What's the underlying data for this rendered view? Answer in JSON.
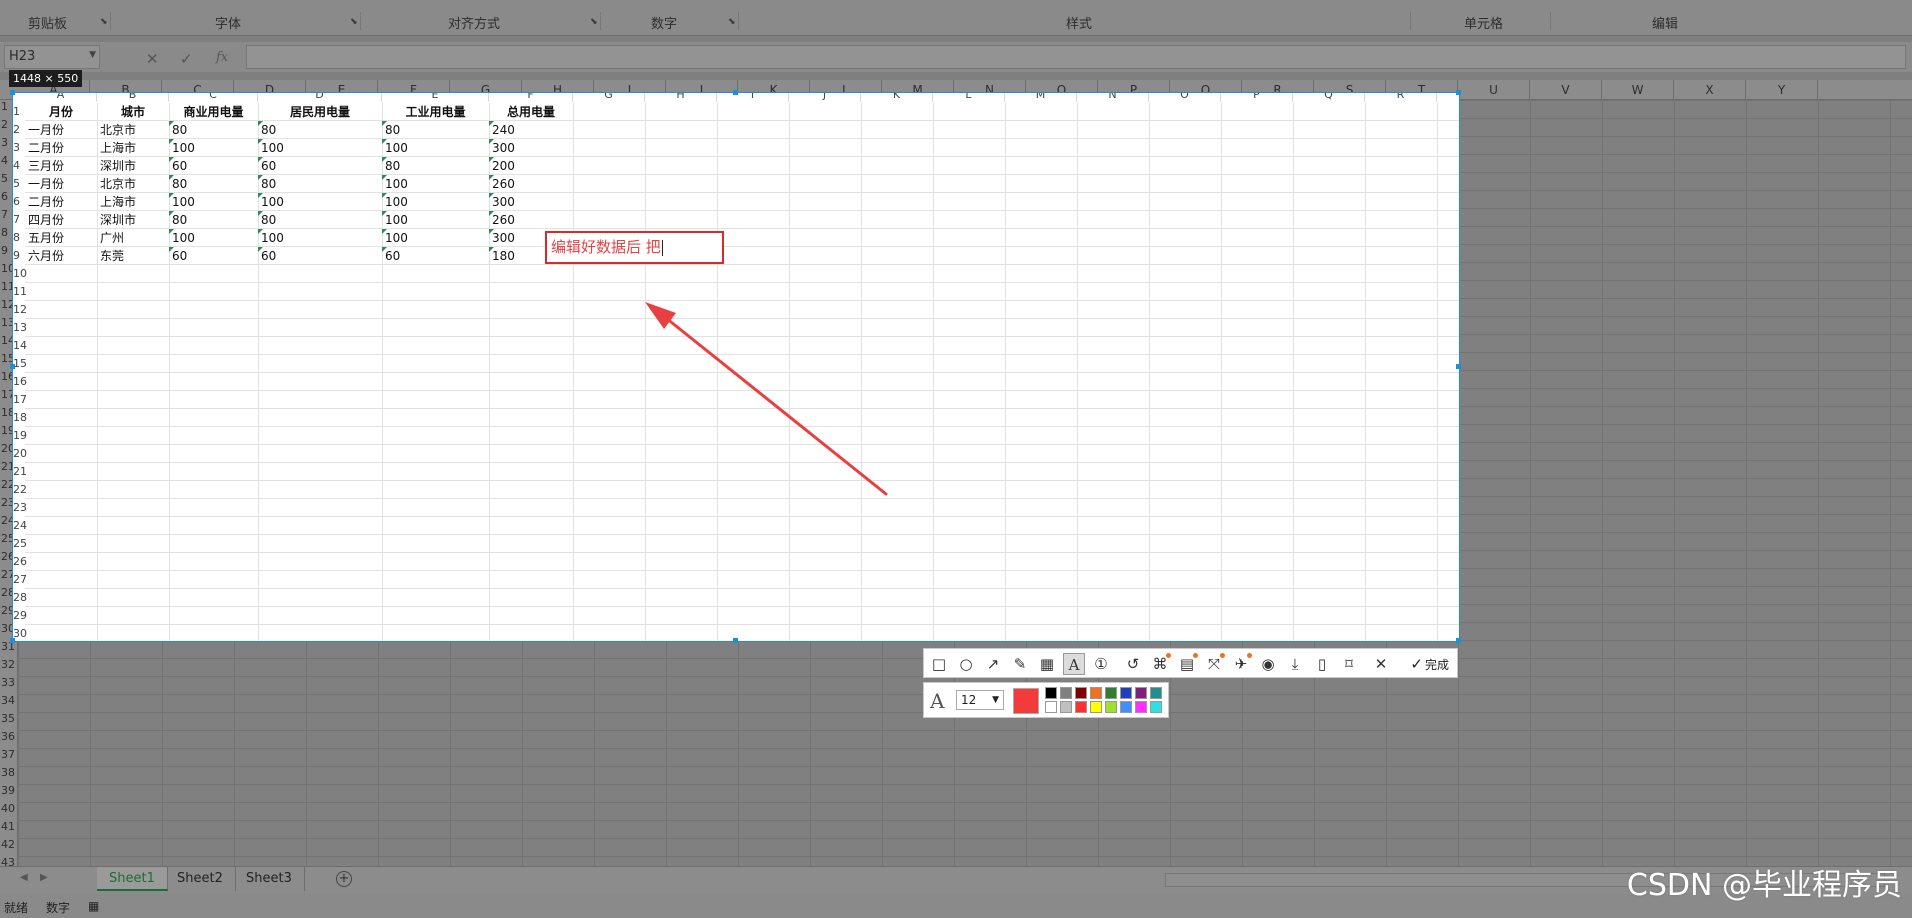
{
  "ribbon": {
    "groups": [
      "剪贴板",
      "字体",
      "对齐方式",
      "数字",
      "样式",
      "单元格",
      "编辑"
    ]
  },
  "formula_bar": {
    "name_box": "H23",
    "cancel_icon": "✕",
    "enter_icon": "✓",
    "fx_label": "fx",
    "value": ""
  },
  "column_letters_outer": [
    "A",
    "B",
    "C",
    "D",
    "E",
    "F",
    "G",
    "H",
    "I",
    "J",
    "K",
    "L",
    "M",
    "N",
    "O",
    "P",
    "Q",
    "R",
    "S",
    "T",
    "U",
    "V",
    "W",
    "X",
    "Y"
  ],
  "row_numbers": [
    "1",
    "2",
    "3",
    "4",
    "5",
    "6",
    "7",
    "8",
    "9",
    "10",
    "11",
    "12",
    "13",
    "14",
    "15",
    "16",
    "17",
    "18",
    "19",
    "20",
    "21",
    "22",
    "23",
    "24",
    "25",
    "26",
    "27",
    "28",
    "29",
    "30",
    "31",
    "32",
    "33",
    "34",
    "35",
    "36",
    "37",
    "38",
    "39",
    "40",
    "41",
    "42",
    "43"
  ],
  "capture": {
    "size_label": "1448 × 550"
  },
  "table": {
    "headers": [
      "月份",
      "城市",
      "商业用电量",
      "居民用电量",
      "工业用电量",
      "总用电量"
    ],
    "rows": [
      [
        "一月份",
        "北京市",
        "80",
        "80",
        "80",
        "240"
      ],
      [
        "二月份",
        "上海市",
        "100",
        "100",
        "100",
        "300"
      ],
      [
        "三月份",
        "深圳市",
        "60",
        "60",
        "80",
        "200"
      ],
      [
        "一月份",
        "北京市",
        "80",
        "80",
        "100",
        "260"
      ],
      [
        "二月份",
        "上海市",
        "100",
        "100",
        "100",
        "300"
      ],
      [
        "四月份",
        "深圳市",
        "80",
        "80",
        "100",
        "260"
      ],
      [
        "五月份",
        "广州",
        "100",
        "100",
        "100",
        "300"
      ],
      [
        "六月份",
        "东莞",
        "60",
        "60",
        "60",
        "180"
      ]
    ]
  },
  "annotation": {
    "text": "编辑好数据后 把",
    "color": "#e14545",
    "border_color": "#d62b2b"
  },
  "toolbar": {
    "tools": [
      "rectangle-icon",
      "ellipse-icon",
      "arrow-icon",
      "pencil-icon",
      "mosaic-icon",
      "text-icon",
      "number-marker-icon",
      "undo-icon",
      "pin-icon",
      "translate-icon",
      "scroll-capture-icon",
      "pin-to-screen-icon",
      "record-icon",
      "download-icon",
      "save-icon",
      "bookmark-icon"
    ],
    "close_label": "✕",
    "done_label": "完成"
  },
  "style_panel": {
    "font_size": "12",
    "current_color": "#f23b3b",
    "palette_top": [
      "#000000",
      "#808080",
      "#800000",
      "#f07020",
      "#2f7f2f",
      "#1f3fbf",
      "#7f1f7f",
      "#1f8f8f"
    ],
    "palette_bottom": [
      "#ffffff",
      "#c0c0c0",
      "#ff3030",
      "#ffff00",
      "#9fdf2f",
      "#3f8fff",
      "#ff30ff",
      "#30dfdf"
    ]
  },
  "sheets": [
    "Sheet1",
    "Sheet2",
    "Sheet3"
  ],
  "status": {
    "ready": "就绪",
    "mode": "数字"
  },
  "watermark": "CSDN @毕业程序员"
}
